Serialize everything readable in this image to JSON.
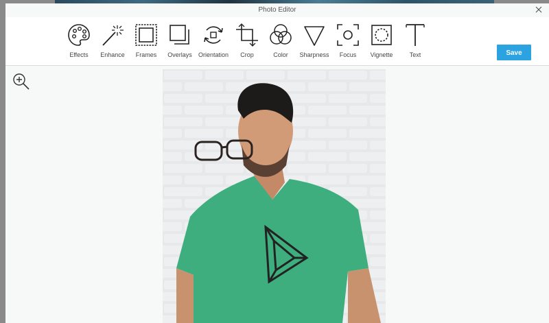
{
  "window": {
    "title": "Photo Editor"
  },
  "toolbar": {
    "tools": [
      {
        "label": "Effects",
        "icon": "palette-icon"
      },
      {
        "label": "Enhance",
        "icon": "magic-wand-icon"
      },
      {
        "label": "Frames",
        "icon": "frame-icon"
      },
      {
        "label": "Overlays",
        "icon": "overlays-icon"
      },
      {
        "label": "Orientation",
        "icon": "rotate-icon"
      },
      {
        "label": "Crop",
        "icon": "crop-icon"
      },
      {
        "label": "Color",
        "icon": "color-circles-icon"
      },
      {
        "label": "Sharpness",
        "icon": "triangle-icon"
      },
      {
        "label": "Focus",
        "icon": "focus-icon"
      },
      {
        "label": "Vignette",
        "icon": "vignette-icon"
      },
      {
        "label": "Text",
        "icon": "text-icon"
      }
    ],
    "save_label": "Save"
  },
  "colors": {
    "accent": "#2aa3e0",
    "shirt": "#3fae7f",
    "wall": "#e4e6e8"
  }
}
